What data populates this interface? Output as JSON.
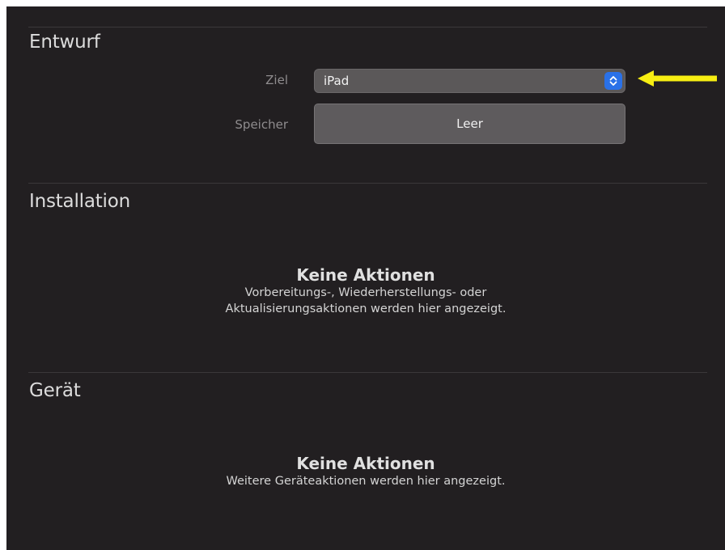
{
  "sections": {
    "entwurf": {
      "title": "Entwurf",
      "ziel": {
        "label": "Ziel",
        "value": "iPad"
      },
      "speicher": {
        "label": "Speicher",
        "button_label": "Leer"
      }
    },
    "installation": {
      "title": "Installation",
      "empty_title": "Keine Aktionen",
      "empty_desc_line1": "Vorbereitungs-, Wiederherstellungs- oder",
      "empty_desc_line2": "Aktualisierungsaktionen werden hier angezeigt."
    },
    "geraet": {
      "title": "Gerät",
      "empty_title": "Keine Aktionen",
      "empty_desc": "Weitere Geräteaktionen werden hier angezeigt."
    }
  },
  "colors": {
    "background": "#221f21",
    "accent_blue": "#2a71e8",
    "annotation_arrow": "#f7ee12"
  },
  "icons": {
    "stepper": "chevron-up-down-icon",
    "annotation": "arrow-left-icon"
  }
}
